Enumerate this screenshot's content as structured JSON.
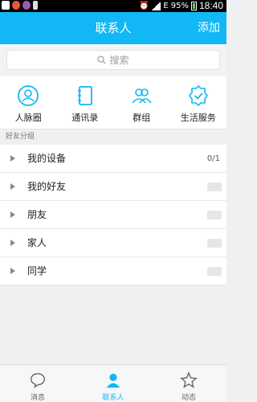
{
  "status_bar": {
    "battery": "95%",
    "time": "18:40",
    "network_badge": "E"
  },
  "header": {
    "title": "联系人",
    "add_label": "添加"
  },
  "search": {
    "placeholder": "搜索"
  },
  "quick_actions": [
    {
      "label": "人脉圈",
      "icon": "person-circle-icon"
    },
    {
      "label": "通讯录",
      "icon": "address-book-icon"
    },
    {
      "label": "群组",
      "icon": "group-icon"
    },
    {
      "label": "生活服务",
      "icon": "service-badge-icon"
    }
  ],
  "section": {
    "title": "好友分组"
  },
  "groups": [
    {
      "label": "我的设备",
      "count": "0/1"
    },
    {
      "label": "我的好友",
      "count": ""
    },
    {
      "label": "朋友",
      "count": ""
    },
    {
      "label": "家人",
      "count": ""
    },
    {
      "label": "同学",
      "count": ""
    }
  ],
  "tabs": [
    {
      "label": "消息",
      "icon": "chat-bubble-icon",
      "active": false
    },
    {
      "label": "联系人",
      "icon": "contacts-icon",
      "active": true
    },
    {
      "label": "动态",
      "icon": "star-icon",
      "active": false
    }
  ],
  "colors": {
    "brand": "#12b7f5",
    "background": "#eef0f2"
  }
}
